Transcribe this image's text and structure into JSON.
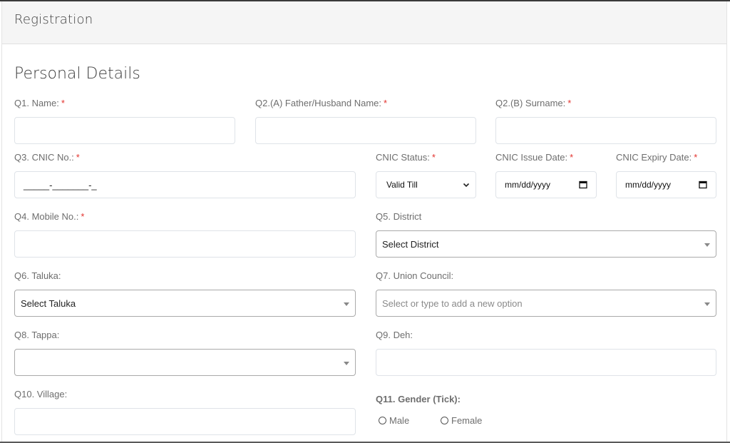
{
  "header": {
    "title": "Registration"
  },
  "section": {
    "title": "Personal Details"
  },
  "required_marker": "*",
  "fields": {
    "q1_name": {
      "label": "Q1. Name:",
      "required": true,
      "value": ""
    },
    "q2a_father": {
      "label": "Q2.(A) Father/Husband Name:",
      "required": true,
      "value": ""
    },
    "q2b_surname": {
      "label": "Q2.(B) Surname:",
      "required": true,
      "value": ""
    },
    "q3_cnic": {
      "label": "Q3. CNIC No.:",
      "required": true,
      "mask": "_____-_______-_"
    },
    "cnic_status": {
      "label": "CNIC Status:",
      "required": true,
      "selected": "Valid Till"
    },
    "cnic_issue_date": {
      "label": "CNIC Issue Date:",
      "required": true,
      "placeholder": "mm/dd/yyyy"
    },
    "cnic_expiry_date": {
      "label": "CNIC Expiry Date:",
      "required": true,
      "placeholder": "mm/dd/yyyy"
    },
    "q4_mobile": {
      "label": "Q4. Mobile No.:",
      "required": true,
      "value": ""
    },
    "q5_district": {
      "label": "Q5. District",
      "selected": "Select District"
    },
    "q6_taluka": {
      "label": "Q6. Taluka:",
      "selected": "Select Taluka"
    },
    "q7_union_council": {
      "label": "Q7. Union Council:",
      "placeholder": "Select or type to add a new option"
    },
    "q8_tappa": {
      "label": "Q8. Tappa:",
      "selected": ""
    },
    "q9_deh": {
      "label": "Q9. Deh:",
      "value": ""
    },
    "q10_village": {
      "label": "Q10. Village:",
      "value": ""
    },
    "q11_gender": {
      "label": "Q11. Gender (Tick):",
      "options": [
        {
          "label": "Male",
          "checked": false
        },
        {
          "label": "Female",
          "checked": false
        }
      ]
    }
  },
  "icons": {
    "select_caret": "chevron-down-icon",
    "date_picker": "calendar-icon",
    "dropdown_arrow": "triangle-down-icon"
  },
  "colors": {
    "required": "#e3342f",
    "header_bg": "#f5f5f5",
    "label": "#6e6e6e"
  }
}
